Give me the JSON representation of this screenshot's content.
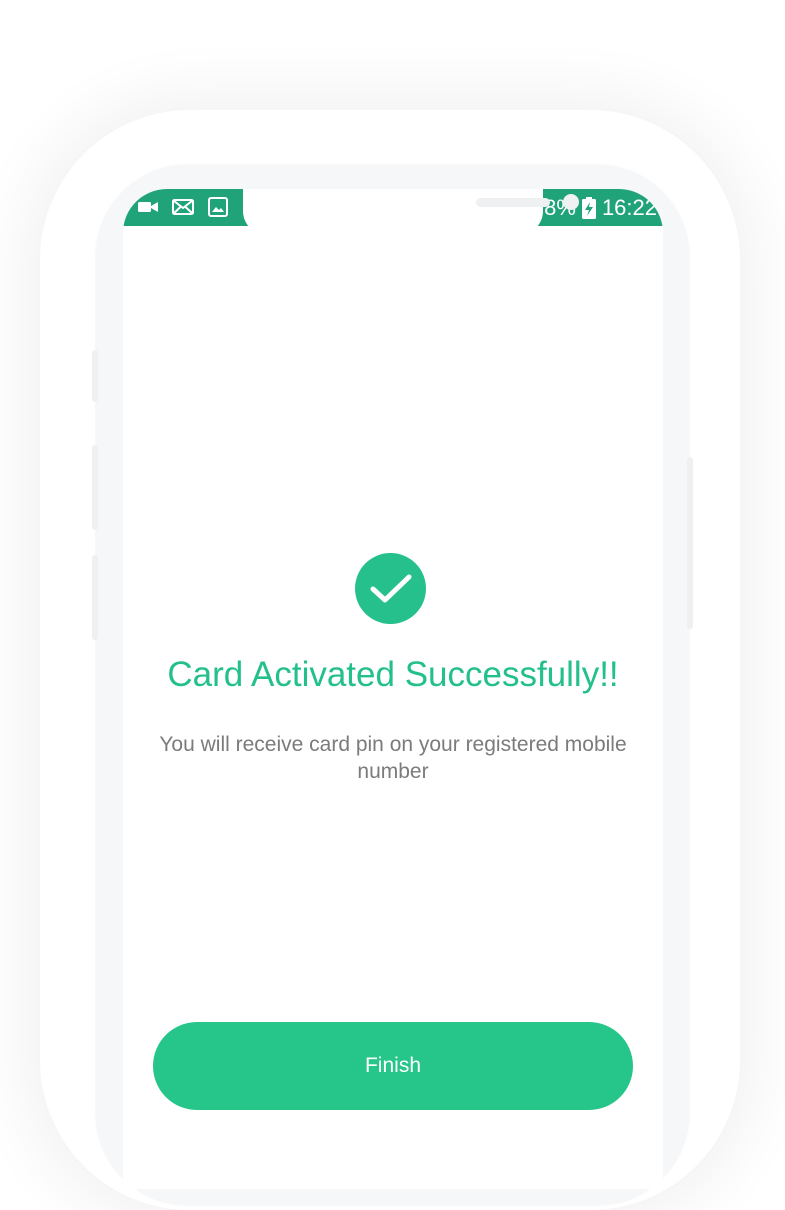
{
  "status_bar": {
    "battery_percent": "8%",
    "time": "16:22",
    "left_icons": [
      "video-call-icon",
      "mail-icon",
      "image-icon"
    ],
    "color": "#21a37a"
  },
  "content": {
    "title": "Card Activated Successfully!!",
    "message": "You will receive card pin on your registered mobile number"
  },
  "actions": {
    "finish_label": "Finish"
  },
  "colors": {
    "accent": "#26c68b",
    "title_text": "#23c08b",
    "body_text": "#7b7b7b"
  },
  "icons": {
    "success": "checkmark-circle-icon",
    "battery": "battery-charging-icon"
  }
}
